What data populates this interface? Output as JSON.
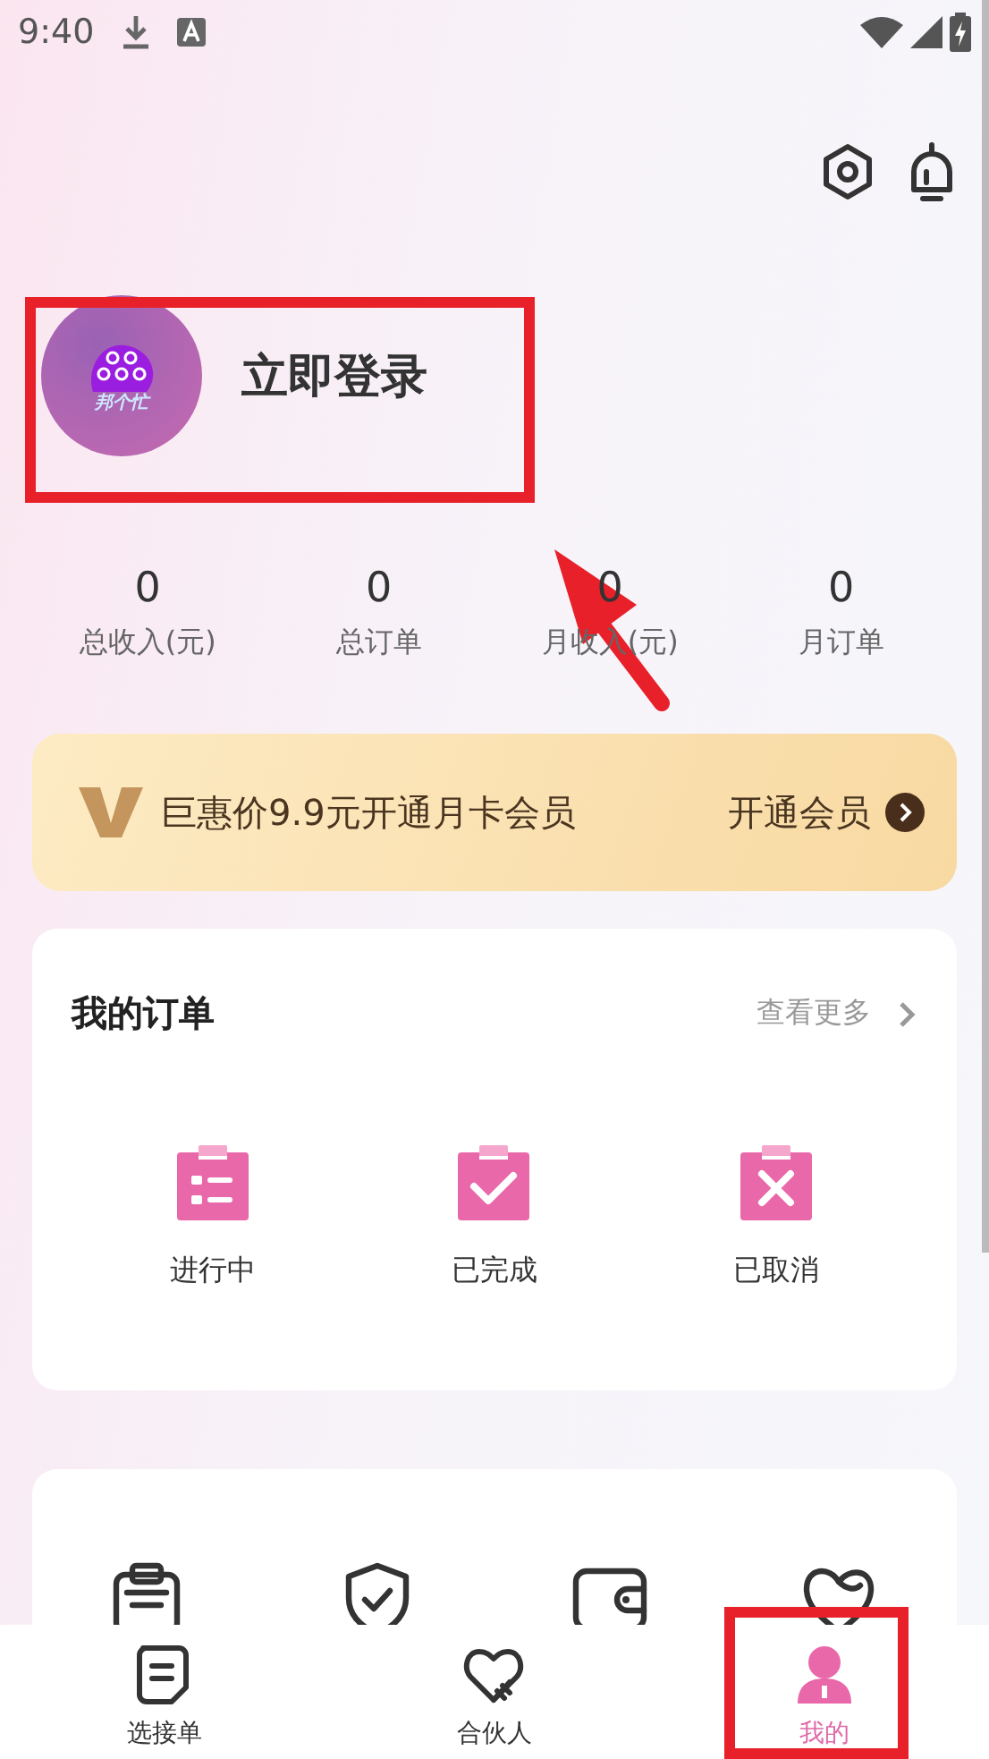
{
  "status_bar": {
    "time": "9:40"
  },
  "profile": {
    "login_text": "立即登录",
    "logo_text": "邦个忙"
  },
  "stats": [
    {
      "value": "0",
      "label": "总收入(元)"
    },
    {
      "value": "0",
      "label": "总订单"
    },
    {
      "value": "0",
      "label": "月收入(元)"
    },
    {
      "value": "0",
      "label": "月订单"
    }
  ],
  "vip_banner": {
    "text": "巨惠价9.9元开通月卡会员",
    "button": "开通会员"
  },
  "orders": {
    "title": "我的订单",
    "more": "查看更多",
    "items": [
      {
        "kind": "list",
        "label": "进行中"
      },
      {
        "kind": "check",
        "label": "已完成"
      },
      {
        "kind": "cross",
        "label": "已取消"
      }
    ]
  },
  "tools": [
    {
      "kind": "clipboard"
    },
    {
      "kind": "shield"
    },
    {
      "kind": "wallet"
    },
    {
      "kind": "heart"
    }
  ],
  "tab_bar": [
    {
      "kind": "note",
      "label": "选接单",
      "selected": false
    },
    {
      "kind": "handshake",
      "label": "合伙人",
      "selected": false
    },
    {
      "kind": "person",
      "label": "我的",
      "selected": true
    }
  ]
}
